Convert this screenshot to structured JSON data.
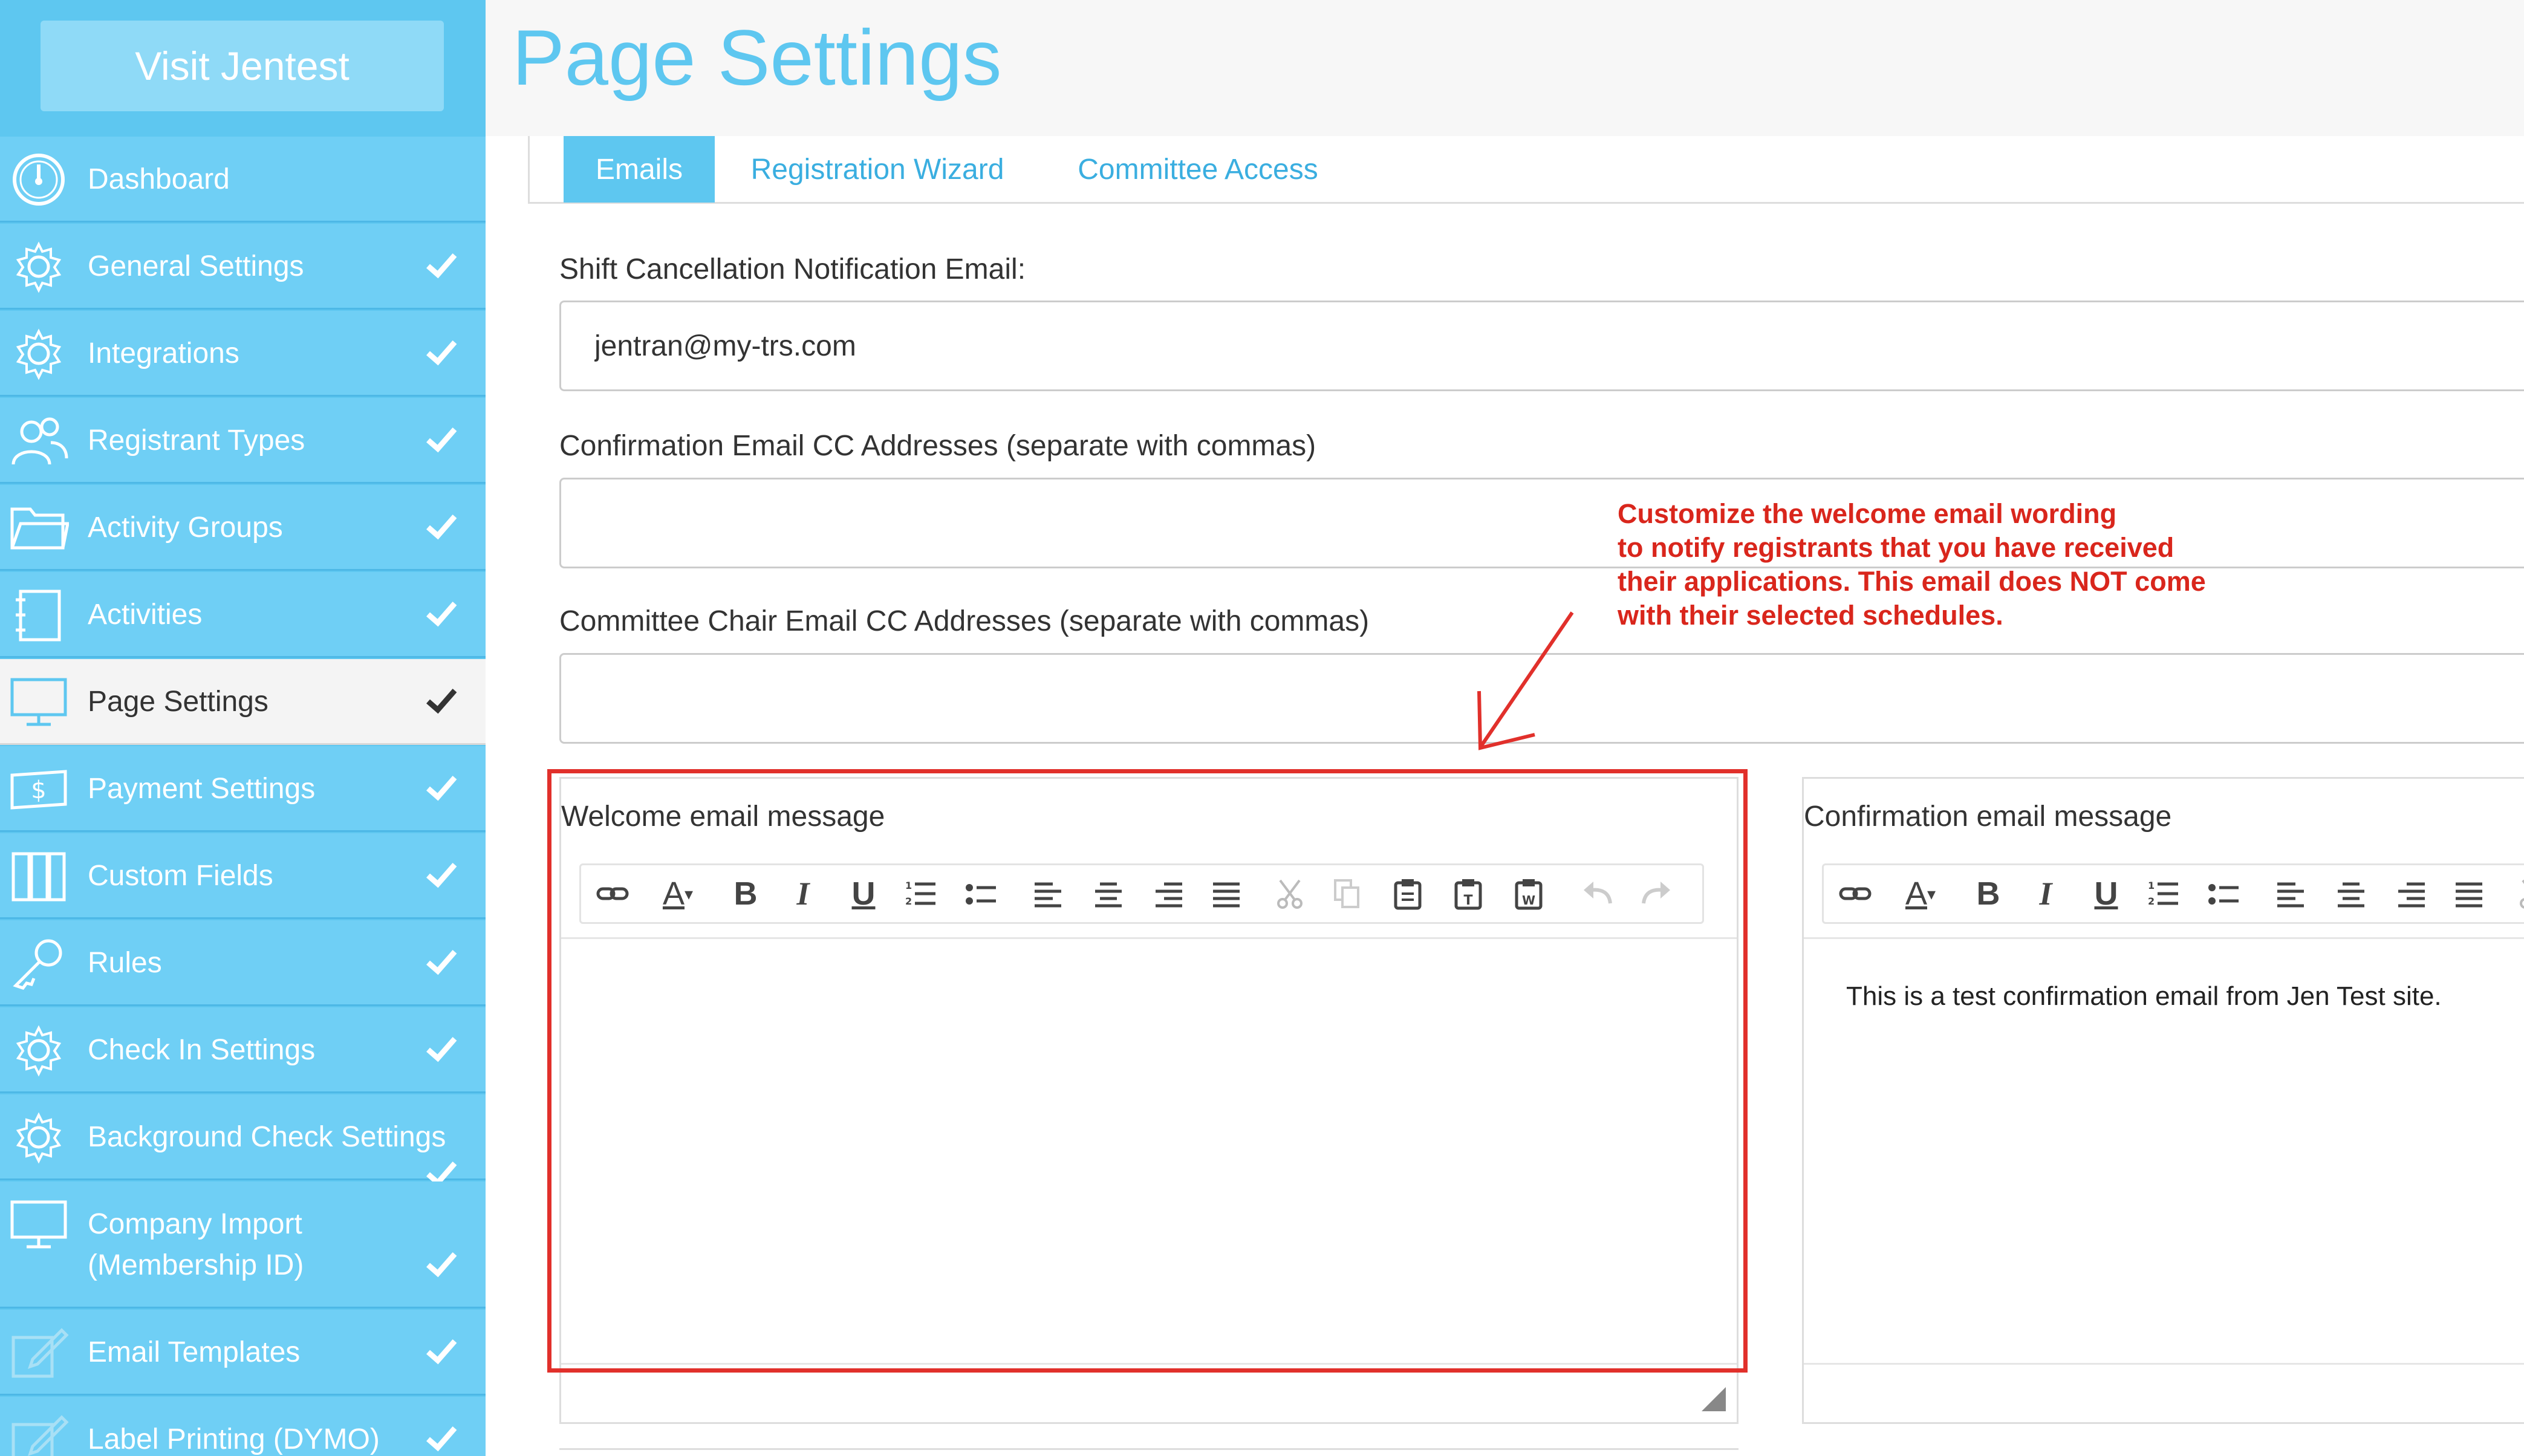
{
  "sidebar": {
    "visit_button": "Visit Jentest",
    "items": [
      {
        "label": "Dashboard",
        "icon": "dashboard-icon",
        "checked": false
      },
      {
        "label": "General Settings",
        "icon": "gear-icon",
        "checked": true
      },
      {
        "label": "Integrations",
        "icon": "gear-icon",
        "checked": true
      },
      {
        "label": "Registrant Types",
        "icon": "users-icon",
        "checked": true
      },
      {
        "label": "Activity Groups",
        "icon": "folder-icon",
        "checked": true
      },
      {
        "label": "Activities",
        "icon": "notebook-icon",
        "checked": true
      },
      {
        "label": "Page Settings",
        "icon": "monitor-icon",
        "checked": true,
        "active": true
      },
      {
        "label": "Payment Settings",
        "icon": "money-icon",
        "checked": true
      },
      {
        "label": "Custom Fields",
        "icon": "columns-icon",
        "checked": true
      },
      {
        "label": "Rules",
        "icon": "key-icon",
        "checked": true
      },
      {
        "label": "Check In Settings",
        "icon": "gear-icon",
        "checked": true
      },
      {
        "label": "Background Check Settings",
        "icon": "gear-icon",
        "checked": true
      },
      {
        "label": "Company Import (Membership ID)",
        "icon": "monitor-icon",
        "checked": true
      },
      {
        "label": "Email Templates",
        "icon": "pencil-icon",
        "checked": true
      },
      {
        "label": "Label Printing (DYMO)",
        "icon": "pencil-icon",
        "checked": true
      }
    ]
  },
  "header": {
    "title": "Page Settings"
  },
  "tabs": [
    {
      "label": "Emails",
      "active": true
    },
    {
      "label": "Registration Wizard",
      "active": false
    },
    {
      "label": "Committee Access",
      "active": false
    }
  ],
  "form": {
    "shift_cancel_label": "Shift Cancellation Notification Email:",
    "shift_cancel_value": "jentran@my-trs.com",
    "confirm_cc_label": "Confirmation Email CC Addresses (separate with commas)",
    "confirm_cc_value": "",
    "committee_cc_label": "Committee Chair Email CC Addresses (separate with commas)",
    "committee_cc_value": ""
  },
  "editors": {
    "welcome_label": "Welcome email message",
    "welcome_body": "",
    "confirmation_label": "Confirmation email message",
    "confirmation_body": "This is a test confirmation email from Jen Test site."
  },
  "toolbar": {
    "font_color_glyph": "A",
    "bold_glyph": "B",
    "italic_glyph": "I",
    "underline_glyph": "U"
  },
  "annotation": {
    "line1": "Customize the welcome email wording",
    "line2": "to notify registrants that you have received",
    "line3": "their applications. This email does NOT come",
    "line4": "with their selected schedules.",
    "color": "#d9261c"
  },
  "colors": {
    "brand": "#5ec7f0",
    "sidebar_item": "#6fcff5",
    "highlight": "#e1302b"
  }
}
